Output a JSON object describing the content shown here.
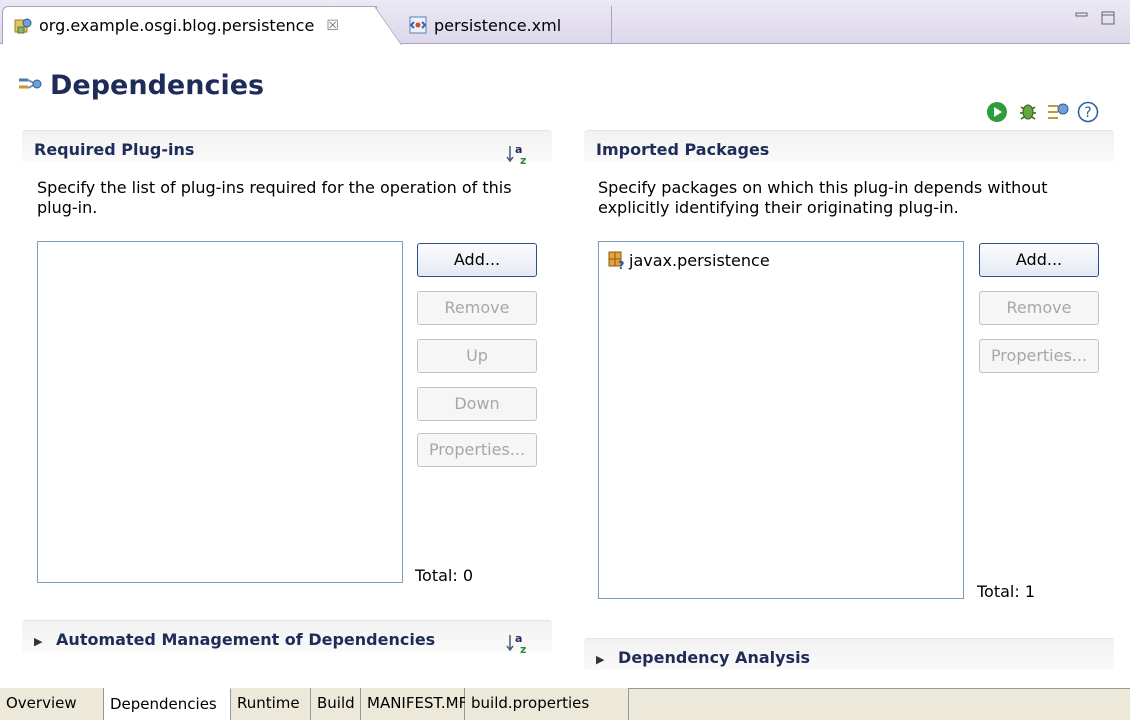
{
  "editor_tabs": [
    {
      "label": "org.example.osgi.blog.persistence",
      "icon": "plugin-manifest-icon",
      "active": true
    },
    {
      "label": "persistence.xml",
      "icon": "xml-file-icon",
      "active": false
    }
  ],
  "editor_tab_close_glyph": "☒",
  "header": {
    "title": "Dependencies"
  },
  "required_plugins": {
    "title": "Required Plug-ins",
    "description": "Specify the list of plug-ins required for the operation of this plug-in.",
    "items": [],
    "buttons": {
      "add": "Add...",
      "remove": "Remove",
      "up": "Up",
      "down": "Down",
      "properties": "Properties..."
    },
    "total": "Total: 0"
  },
  "imported_packages": {
    "title": "Imported Packages",
    "description": "Specify packages on which this plug-in depends without explicitly identifying their originating plug-in.",
    "items": [
      {
        "label": "javax.persistence",
        "icon": "package-import-icon"
      }
    ],
    "buttons": {
      "add": "Add...",
      "remove": "Remove",
      "properties": "Properties..."
    },
    "total": "Total: 1"
  },
  "collapsed_sections": {
    "automated": "Automated Management of Dependencies",
    "analysis": "Dependency Analysis"
  },
  "bottom_tabs": [
    "Overview",
    "Dependencies",
    "Runtime",
    "Build",
    "MANIFEST.MF",
    "build.properties"
  ],
  "active_bottom_tab": "Dependencies",
  "colors": {
    "title": "#1f2c59",
    "list_border": "#7f9db9",
    "accent_button_border": "#2d4f8d"
  }
}
